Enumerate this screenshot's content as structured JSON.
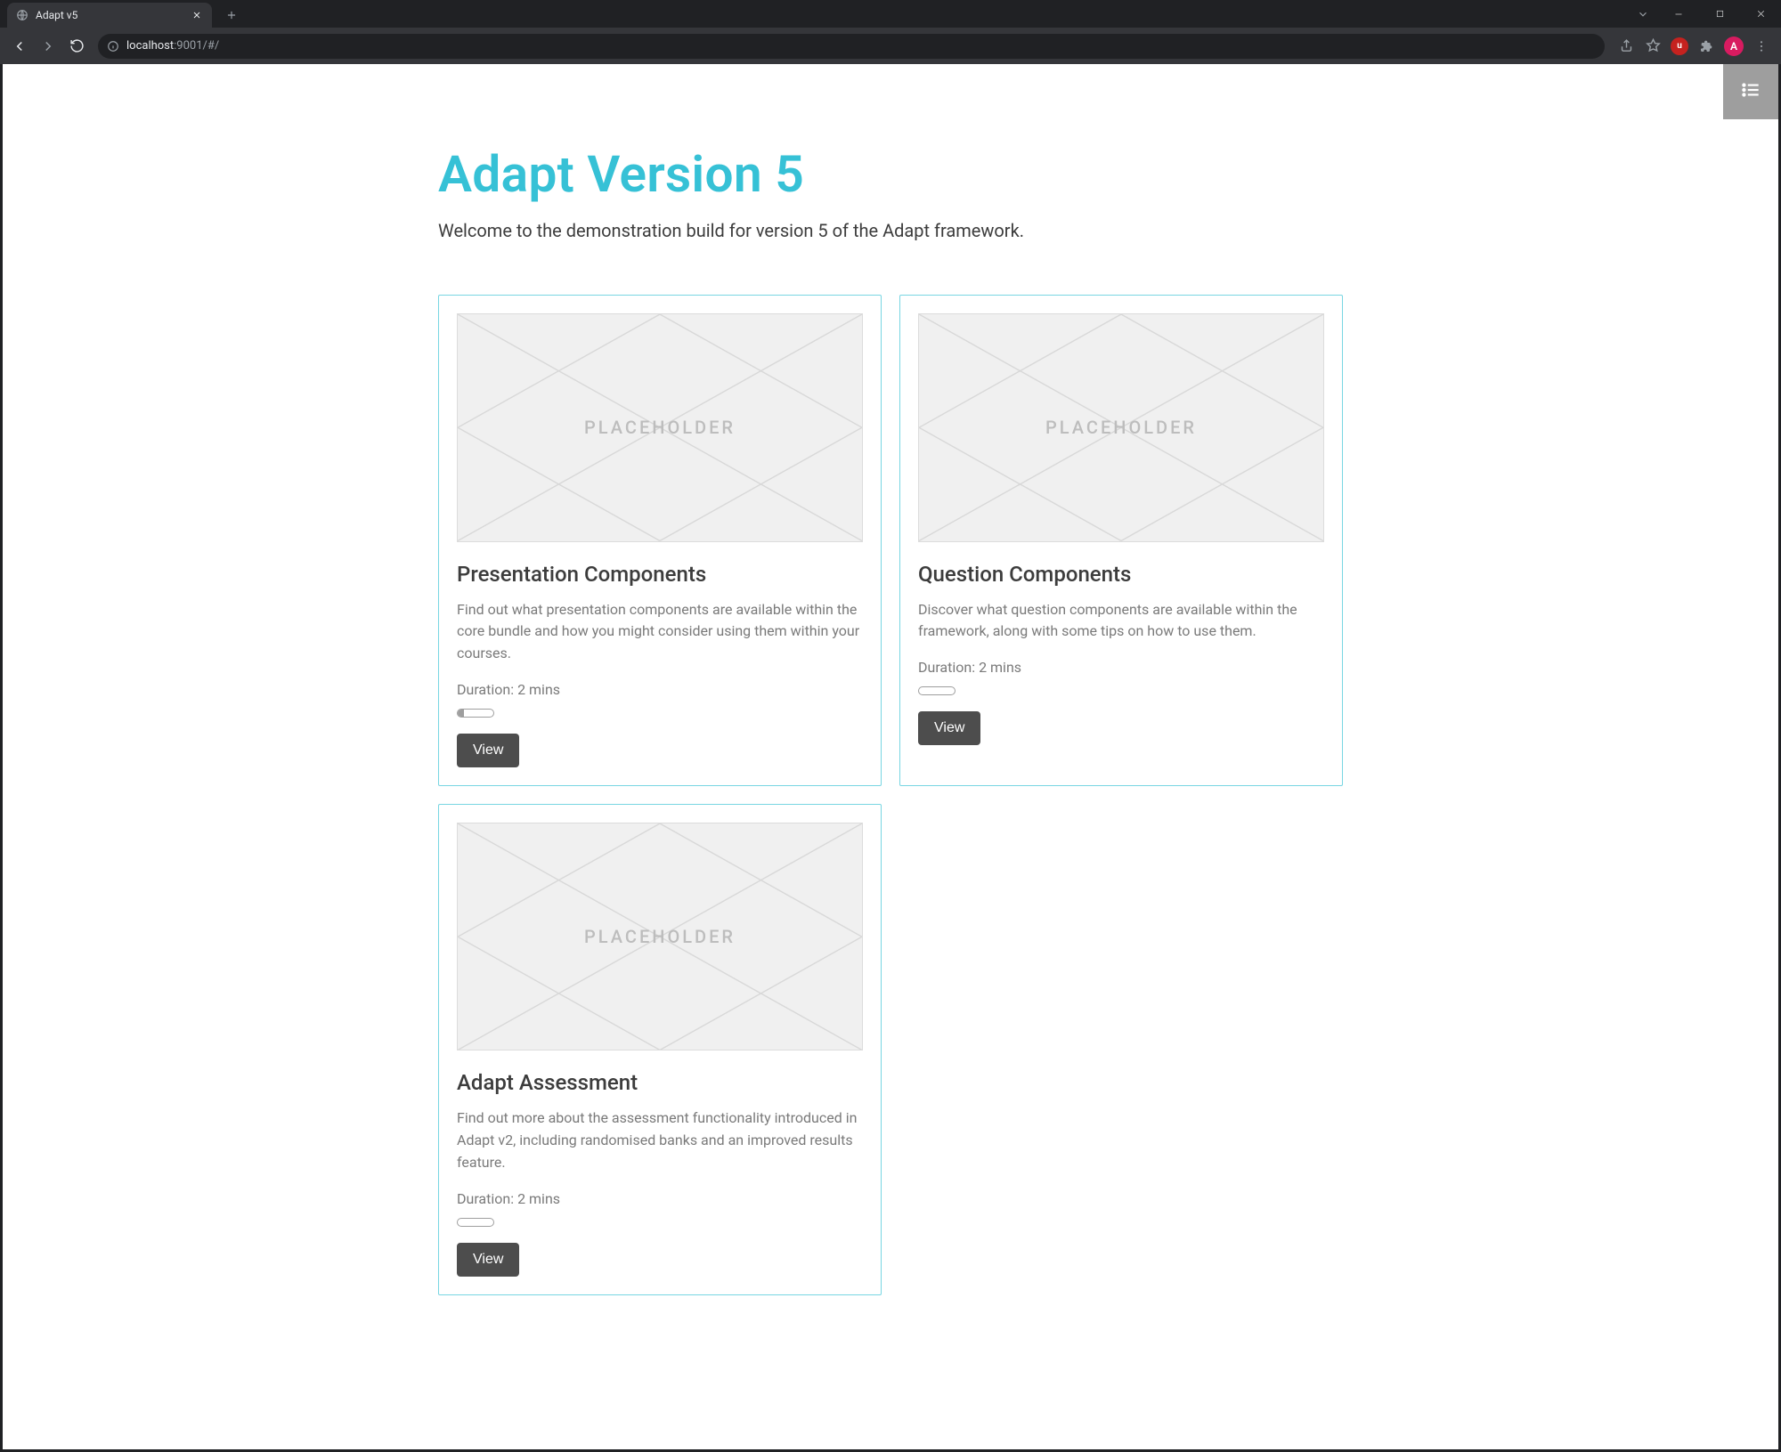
{
  "browser": {
    "tab_title": "Adapt v5",
    "url_host": "localhost",
    "url_rest": ":9001/#/",
    "avatar_initial": "A",
    "ext_label": "u"
  },
  "page": {
    "title": "Adapt Version 5",
    "subtitle": "Welcome to the demonstration build for version 5 of the Adapt framework.",
    "placeholder_label": "PLACEHOLDER"
  },
  "cards": [
    {
      "title": "Presentation Components",
      "description": "Find out what presentation components are available within the core bundle and how you might consider using them within your courses.",
      "duration": "Duration: 2 mins",
      "button": "View",
      "progress": 18
    },
    {
      "title": "Question Components",
      "description": "Discover what question components are available within the framework, along with some tips on how to use them.",
      "duration": "Duration: 2 mins",
      "button": "View",
      "progress": 0
    },
    {
      "title": "Adapt Assessment",
      "description": "Find out more about the assessment functionality introduced in Adapt v2, including randomised banks and an improved results feature.",
      "duration": "Duration: 2 mins",
      "button": "View",
      "progress": 0
    }
  ]
}
